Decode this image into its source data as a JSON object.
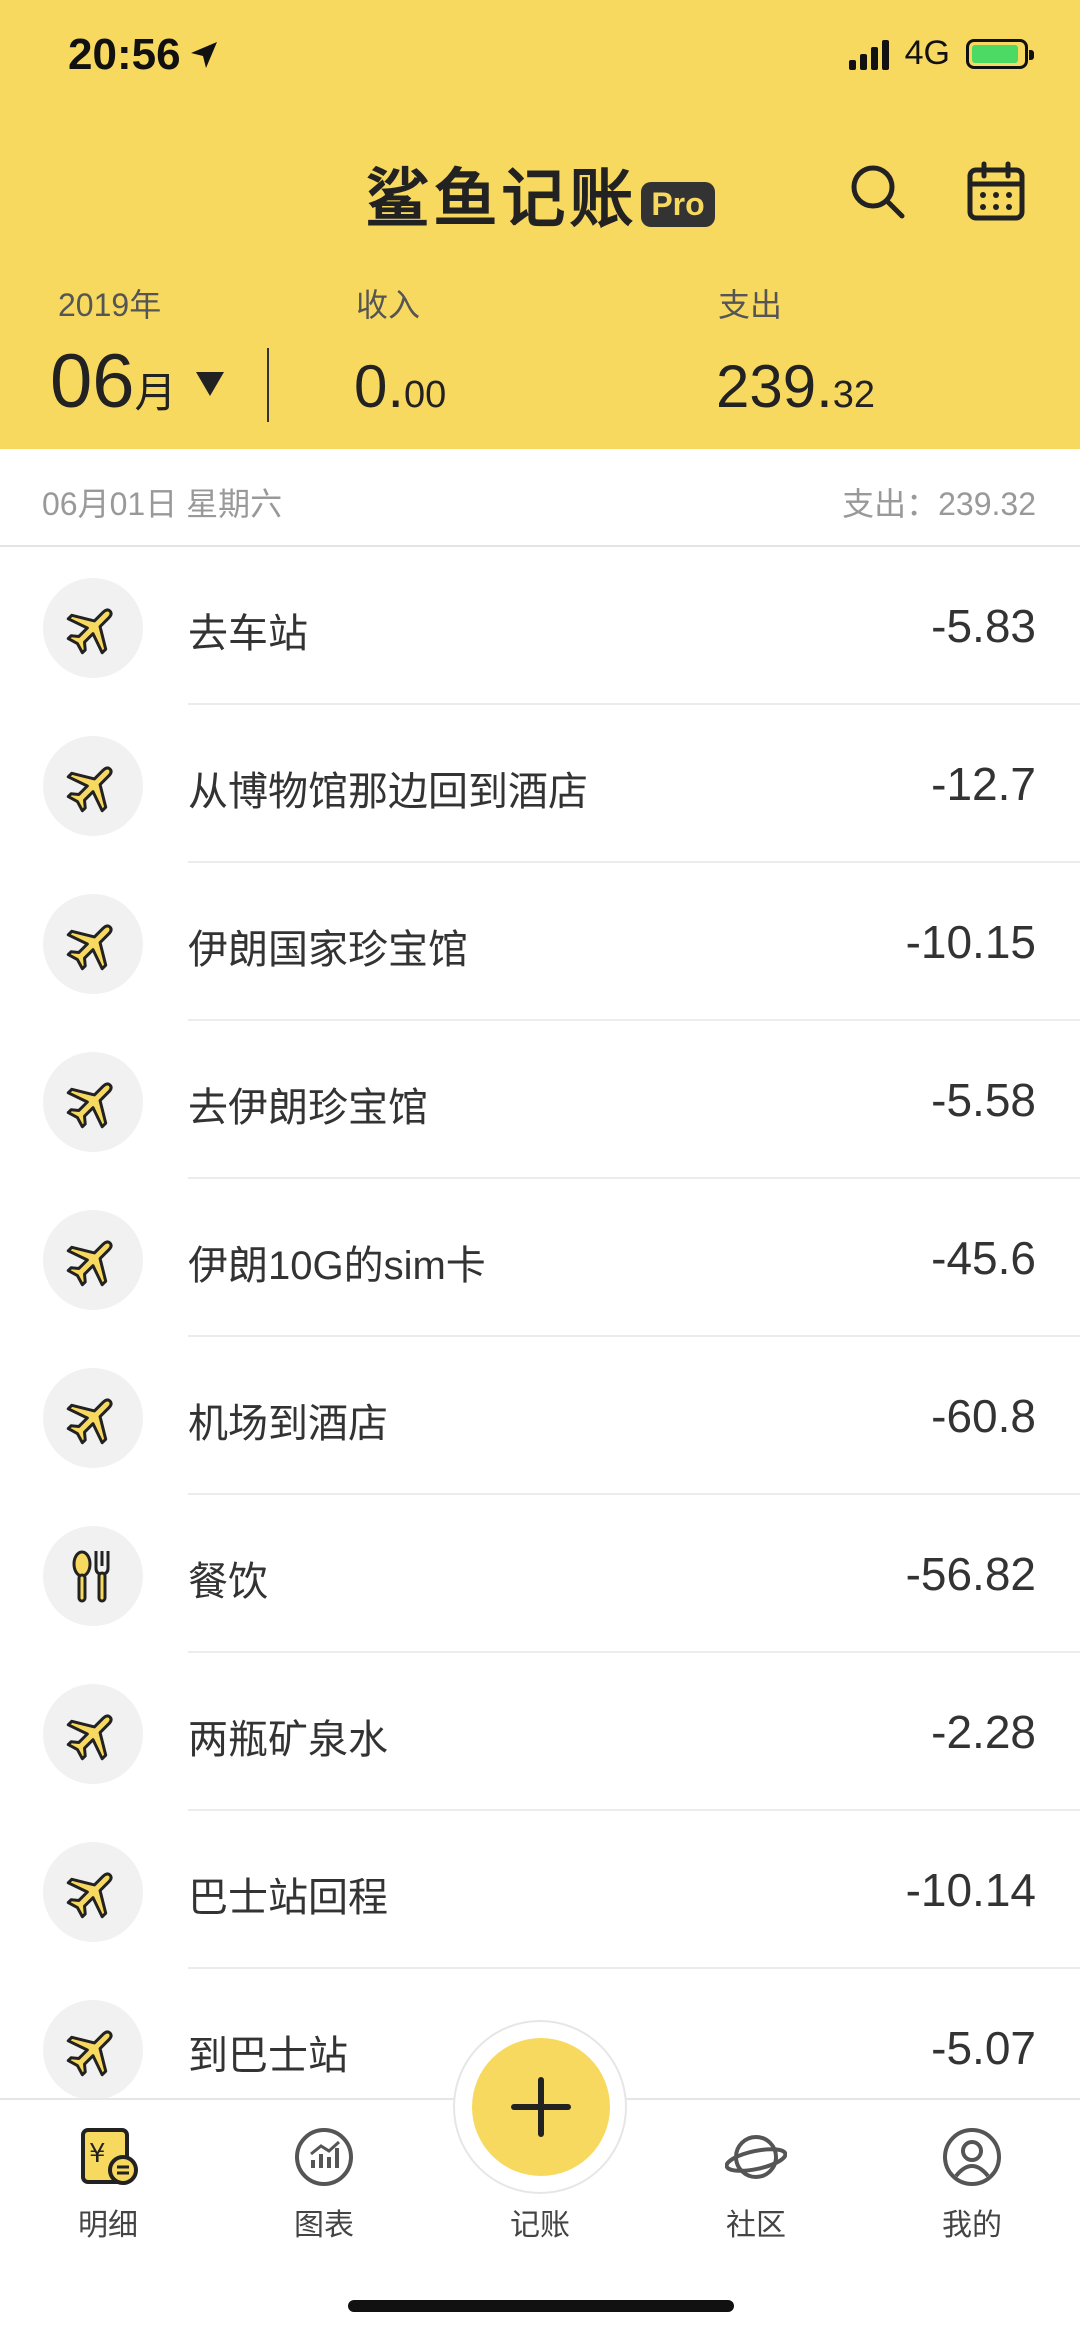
{
  "status_bar": {
    "time": "20:56",
    "network": "4G"
  },
  "header": {
    "app_title": "鲨鱼记账",
    "pro_badge": "Pro",
    "year": "2019年",
    "month_number": "06",
    "month_suffix": "月",
    "income_label": "收入",
    "income_int": "0.",
    "income_dec": "00",
    "expense_label": "支出",
    "expense_int": "239.",
    "expense_dec": "32"
  },
  "day": {
    "date": "06月01日  星期六",
    "total": "支出：239.32"
  },
  "items": [
    {
      "icon": "airplane-icon",
      "label": "去车站",
      "amount": "-5.83"
    },
    {
      "icon": "airplane-icon",
      "label": "从博物馆那边回到酒店",
      "amount": "-12.7"
    },
    {
      "icon": "airplane-icon",
      "label": "伊朗国家珍宝馆",
      "amount": "-10.15"
    },
    {
      "icon": "airplane-icon",
      "label": "去伊朗珍宝馆",
      "amount": "-5.58"
    },
    {
      "icon": "airplane-icon",
      "label": "伊朗10G的sim卡",
      "amount": "-45.6"
    },
    {
      "icon": "airplane-icon",
      "label": "机场到酒店",
      "amount": "-60.8"
    },
    {
      "icon": "utensils-icon",
      "label": "餐饮",
      "amount": "-56.82"
    },
    {
      "icon": "airplane-icon",
      "label": "两瓶矿泉水",
      "amount": "-2.28"
    },
    {
      "icon": "airplane-icon",
      "label": "巴士站回程",
      "amount": "-10.14"
    },
    {
      "icon": "airplane-icon",
      "label": "到巴士站",
      "amount": "-5.07"
    }
  ],
  "tabbar": {
    "details": "明细",
    "charts": "图表",
    "add": "记账",
    "community": "社区",
    "mine": "我的"
  },
  "colors": {
    "brand_yellow": "#f8d95f",
    "icon_fill": "#f8d95f",
    "icon_stroke": "#222222"
  }
}
